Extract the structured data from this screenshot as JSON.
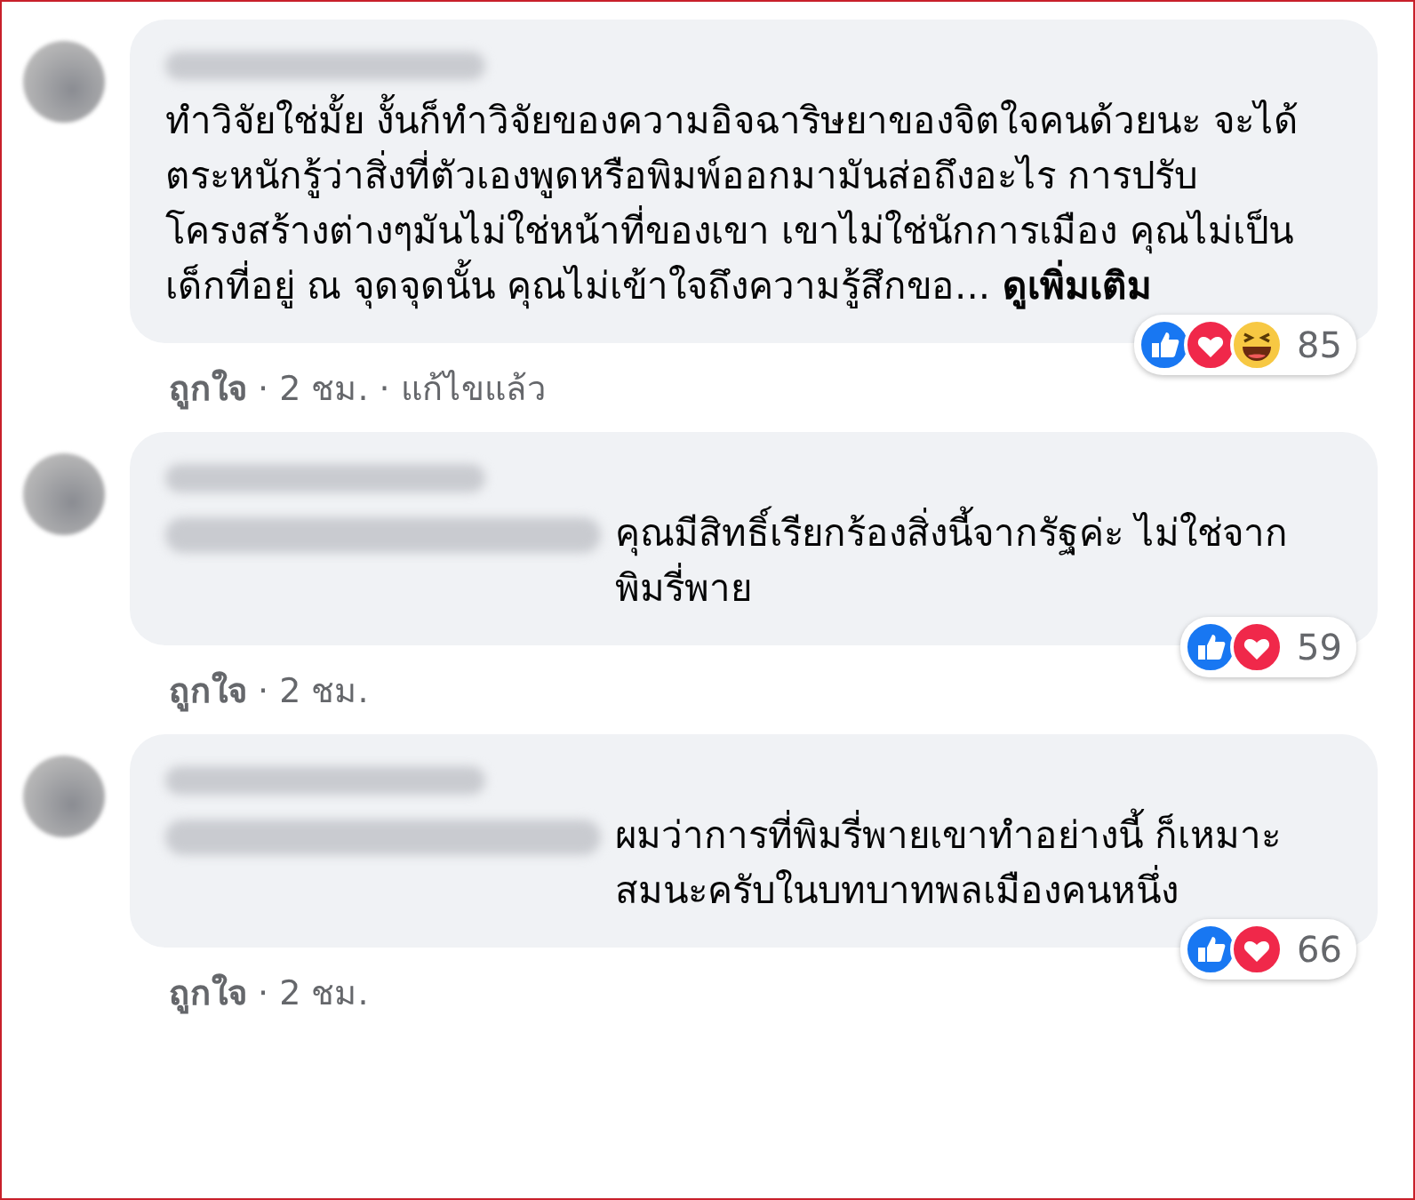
{
  "comments": [
    {
      "text": "ทำวิจัยใช่มั้ย งั้นก็ทำวิจัยของความอิจฉาริษยาของจิตใจคนด้วยนะ จะได้ตระหนักรู้ว่าสิ่งที่ตัวเองพูดหรือพิมพ์ออกมามันส่อถึงอะไร การปรับโครงสร้างต่างๆมันไม่ใช่หน้าที่ของเขา เขาไม่ใช่นักการเมือง คุณไม่เป็นเด็กที่อยู่ ณ จุดจุดนั้น คุณไม่เข้าใจถึงความรู้สึกขอ...",
      "mention": false,
      "see_more": "ดูเพิ่มเติม",
      "reactions": [
        {
          "kind": "like"
        },
        {
          "kind": "love"
        },
        {
          "kind": "haha"
        }
      ],
      "count": "85",
      "like": "ถูกใจ",
      "time": "· 2 ชม.",
      "edited": "· แก้ไขแล้ว"
    },
    {
      "text": "คุณมีสิทธิ์เรียกร้องสิ่งนี้จากรัฐค่ะ ไม่ใช่จากพิมรี่พาย",
      "mention": true,
      "reactions": [
        {
          "kind": "like"
        },
        {
          "kind": "love"
        }
      ],
      "count": "59",
      "like": "ถูกใจ",
      "time": "· 2 ชม."
    },
    {
      "text": "ผมว่าการที่พิมรี่พายเขาทำอย่างนี้ ก็เหมาะสมนะครับในบทบาทพลเมืองคนหนึ่ง",
      "mention": true,
      "reactions": [
        {
          "kind": "like"
        },
        {
          "kind": "love"
        }
      ],
      "count": "66",
      "like": "ถูกใจ",
      "time": "· 2 ชม."
    }
  ]
}
